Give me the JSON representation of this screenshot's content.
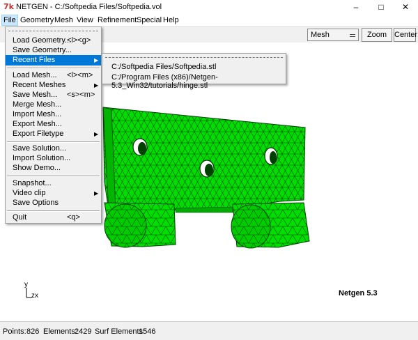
{
  "window": {
    "title": "NETGEN - C:/Softpedia Files/Softpedia.vol",
    "logo_text": "7k",
    "minimize": "–",
    "maximize": "□",
    "close": "✕"
  },
  "menubar": [
    "File",
    "Geometry",
    "Mesh",
    "View",
    "Refinement",
    "Special",
    "Help"
  ],
  "toolbar": {
    "mode_select": "Mesh",
    "zoom_all": "Zoom All",
    "center": "Center"
  },
  "file_menu": [
    {
      "label": "Load Geometry...",
      "accel": "<l><g>"
    },
    {
      "label": "Save Geometry...",
      "accel": ""
    },
    {
      "label": "Recent Files",
      "accel": "",
      "submenu": true
    },
    {
      "label": "Load Mesh...",
      "accel": "<l><m>"
    },
    {
      "label": "Recent Meshes",
      "accel": "",
      "submenu": true
    },
    {
      "label": "Save Mesh...",
      "accel": "<s><m>"
    },
    {
      "label": "Merge Mesh...",
      "accel": ""
    },
    {
      "label": "Import Mesh...",
      "accel": ""
    },
    {
      "label": "Export Mesh...",
      "accel": ""
    },
    {
      "label": "Export Filetype",
      "accel": "",
      "submenu": true
    },
    {
      "label": "Save Solution...",
      "accel": ""
    },
    {
      "label": "Import Solution...",
      "accel": ""
    },
    {
      "label": "Show Demo...",
      "accel": ""
    },
    {
      "label": "Snapshot...",
      "accel": ""
    },
    {
      "label": "Video clip",
      "accel": "",
      "submenu": true
    },
    {
      "label": "Save Options",
      "accel": ""
    },
    {
      "label": "Quit",
      "accel": "<q>"
    }
  ],
  "recent_files": [
    "C:/Softpedia Files/Softpedia.stl",
    "C:/Program Files (x86)/Netgen-5.3_Win32/tutorials/hinge.stl"
  ],
  "viewport": {
    "version_label": "Netgen 5.3",
    "axis_y": "y",
    "axis_zx": "zx",
    "mesh_color": "#00e000",
    "edge_color": "#004000"
  },
  "status": {
    "points_label": "Points:",
    "points": "826",
    "elements_label": "Elements:",
    "elements": "2429",
    "surf_label": "Surf Elements:",
    "surf": "1546"
  }
}
